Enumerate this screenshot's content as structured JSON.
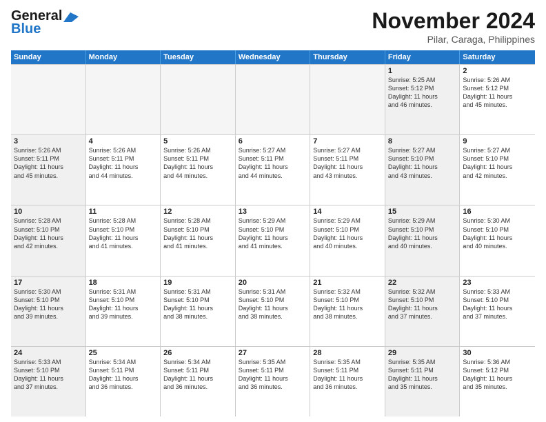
{
  "header": {
    "logo_general": "General",
    "logo_blue": "Blue",
    "month_title": "November 2024",
    "subtitle": "Pilar, Caraga, Philippines"
  },
  "calendar": {
    "headers": [
      "Sunday",
      "Monday",
      "Tuesday",
      "Wednesday",
      "Thursday",
      "Friday",
      "Saturday"
    ],
    "rows": [
      [
        {
          "day": "",
          "text": "",
          "empty": true
        },
        {
          "day": "",
          "text": "",
          "empty": true
        },
        {
          "day": "",
          "text": "",
          "empty": true
        },
        {
          "day": "",
          "text": "",
          "empty": true
        },
        {
          "day": "",
          "text": "",
          "empty": true
        },
        {
          "day": "1",
          "text": "Sunrise: 5:25 AM\nSunset: 5:12 PM\nDaylight: 11 hours\nand 46 minutes.",
          "shaded": true
        },
        {
          "day": "2",
          "text": "Sunrise: 5:26 AM\nSunset: 5:12 PM\nDaylight: 11 hours\nand 45 minutes.",
          "shaded": false
        }
      ],
      [
        {
          "day": "3",
          "text": "Sunrise: 5:26 AM\nSunset: 5:11 PM\nDaylight: 11 hours\nand 45 minutes.",
          "shaded": true
        },
        {
          "day": "4",
          "text": "Sunrise: 5:26 AM\nSunset: 5:11 PM\nDaylight: 11 hours\nand 44 minutes.",
          "shaded": false
        },
        {
          "day": "5",
          "text": "Sunrise: 5:26 AM\nSunset: 5:11 PM\nDaylight: 11 hours\nand 44 minutes.",
          "shaded": false
        },
        {
          "day": "6",
          "text": "Sunrise: 5:27 AM\nSunset: 5:11 PM\nDaylight: 11 hours\nand 44 minutes.",
          "shaded": false
        },
        {
          "day": "7",
          "text": "Sunrise: 5:27 AM\nSunset: 5:11 PM\nDaylight: 11 hours\nand 43 minutes.",
          "shaded": false
        },
        {
          "day": "8",
          "text": "Sunrise: 5:27 AM\nSunset: 5:10 PM\nDaylight: 11 hours\nand 43 minutes.",
          "shaded": true
        },
        {
          "day": "9",
          "text": "Sunrise: 5:27 AM\nSunset: 5:10 PM\nDaylight: 11 hours\nand 42 minutes.",
          "shaded": false
        }
      ],
      [
        {
          "day": "10",
          "text": "Sunrise: 5:28 AM\nSunset: 5:10 PM\nDaylight: 11 hours\nand 42 minutes.",
          "shaded": true
        },
        {
          "day": "11",
          "text": "Sunrise: 5:28 AM\nSunset: 5:10 PM\nDaylight: 11 hours\nand 41 minutes.",
          "shaded": false
        },
        {
          "day": "12",
          "text": "Sunrise: 5:28 AM\nSunset: 5:10 PM\nDaylight: 11 hours\nand 41 minutes.",
          "shaded": false
        },
        {
          "day": "13",
          "text": "Sunrise: 5:29 AM\nSunset: 5:10 PM\nDaylight: 11 hours\nand 41 minutes.",
          "shaded": false
        },
        {
          "day": "14",
          "text": "Sunrise: 5:29 AM\nSunset: 5:10 PM\nDaylight: 11 hours\nand 40 minutes.",
          "shaded": false
        },
        {
          "day": "15",
          "text": "Sunrise: 5:29 AM\nSunset: 5:10 PM\nDaylight: 11 hours\nand 40 minutes.",
          "shaded": true
        },
        {
          "day": "16",
          "text": "Sunrise: 5:30 AM\nSunset: 5:10 PM\nDaylight: 11 hours\nand 40 minutes.",
          "shaded": false
        }
      ],
      [
        {
          "day": "17",
          "text": "Sunrise: 5:30 AM\nSunset: 5:10 PM\nDaylight: 11 hours\nand 39 minutes.",
          "shaded": true
        },
        {
          "day": "18",
          "text": "Sunrise: 5:31 AM\nSunset: 5:10 PM\nDaylight: 11 hours\nand 39 minutes.",
          "shaded": false
        },
        {
          "day": "19",
          "text": "Sunrise: 5:31 AM\nSunset: 5:10 PM\nDaylight: 11 hours\nand 38 minutes.",
          "shaded": false
        },
        {
          "day": "20",
          "text": "Sunrise: 5:31 AM\nSunset: 5:10 PM\nDaylight: 11 hours\nand 38 minutes.",
          "shaded": false
        },
        {
          "day": "21",
          "text": "Sunrise: 5:32 AM\nSunset: 5:10 PM\nDaylight: 11 hours\nand 38 minutes.",
          "shaded": false
        },
        {
          "day": "22",
          "text": "Sunrise: 5:32 AM\nSunset: 5:10 PM\nDaylight: 11 hours\nand 37 minutes.",
          "shaded": true
        },
        {
          "day": "23",
          "text": "Sunrise: 5:33 AM\nSunset: 5:10 PM\nDaylight: 11 hours\nand 37 minutes.",
          "shaded": false
        }
      ],
      [
        {
          "day": "24",
          "text": "Sunrise: 5:33 AM\nSunset: 5:10 PM\nDaylight: 11 hours\nand 37 minutes.",
          "shaded": true
        },
        {
          "day": "25",
          "text": "Sunrise: 5:34 AM\nSunset: 5:11 PM\nDaylight: 11 hours\nand 36 minutes.",
          "shaded": false
        },
        {
          "day": "26",
          "text": "Sunrise: 5:34 AM\nSunset: 5:11 PM\nDaylight: 11 hours\nand 36 minutes.",
          "shaded": false
        },
        {
          "day": "27",
          "text": "Sunrise: 5:35 AM\nSunset: 5:11 PM\nDaylight: 11 hours\nand 36 minutes.",
          "shaded": false
        },
        {
          "day": "28",
          "text": "Sunrise: 5:35 AM\nSunset: 5:11 PM\nDaylight: 11 hours\nand 36 minutes.",
          "shaded": false
        },
        {
          "day": "29",
          "text": "Sunrise: 5:35 AM\nSunset: 5:11 PM\nDaylight: 11 hours\nand 35 minutes.",
          "shaded": true
        },
        {
          "day": "30",
          "text": "Sunrise: 5:36 AM\nSunset: 5:12 PM\nDaylight: 11 hours\nand 35 minutes.",
          "shaded": false
        }
      ]
    ]
  }
}
